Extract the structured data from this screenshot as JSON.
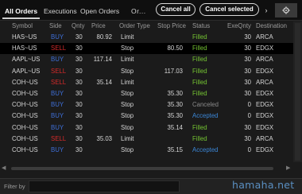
{
  "tabs": [
    {
      "label": "All Orders",
      "active": true
    },
    {
      "label": "Executions",
      "active": false
    },
    {
      "label": "Open Orders",
      "active": false
    },
    {
      "label": "Or...",
      "active": false
    }
  ],
  "toolbar": {
    "cancel_all": "Cancel all",
    "cancel_selected": "Cancel selected",
    "more_glyph": "›"
  },
  "table": {
    "columns": [
      "Symbol",
      "Side",
      "Qnty",
      "Price",
      "Order Type",
      "Stop Price",
      "Status",
      "ExeQnty",
      "Destination"
    ],
    "rows": [
      {
        "symbol": "HAS~US",
        "side": "BUY",
        "qnty": "30",
        "price": "80.92",
        "order_type": "Limit",
        "stop_price": "",
        "status": "Filled",
        "exe_qnty": "30",
        "destination": "ARCA"
      },
      {
        "symbol": "HAS~US",
        "side": "SELL",
        "qnty": "30",
        "price": "",
        "order_type": "Stop",
        "stop_price": "80.50",
        "status": "Filled",
        "exe_qnty": "30",
        "destination": "EDGX",
        "selected": true
      },
      {
        "symbol": "AAPL~US",
        "side": "BUY",
        "qnty": "30",
        "price": "117.14",
        "order_type": "Limit",
        "stop_price": "",
        "status": "Filled",
        "exe_qnty": "30",
        "destination": "ARCA"
      },
      {
        "symbol": "AAPL~US",
        "side": "SELL",
        "qnty": "30",
        "price": "",
        "order_type": "Stop",
        "stop_price": "117.03",
        "status": "Filled",
        "exe_qnty": "30",
        "destination": "EDGX"
      },
      {
        "symbol": "COH~US",
        "side": "SELL",
        "qnty": "30",
        "price": "35.14",
        "order_type": "Limit",
        "stop_price": "",
        "status": "Filled",
        "exe_qnty": "30",
        "destination": "ARCA"
      },
      {
        "symbol": "COH~US",
        "side": "BUY",
        "qnty": "30",
        "price": "",
        "order_type": "Stop",
        "stop_price": "35.30",
        "status": "Filled",
        "exe_qnty": "30",
        "destination": "EDGX"
      },
      {
        "symbol": "COH~US",
        "side": "BUY",
        "qnty": "30",
        "price": "",
        "order_type": "Stop",
        "stop_price": "35.30",
        "status": "Canceled",
        "exe_qnty": "0",
        "destination": "EDGX"
      },
      {
        "symbol": "COH~US",
        "side": "BUY",
        "qnty": "30",
        "price": "",
        "order_type": "Stop",
        "stop_price": "35.30",
        "status": "Accepted",
        "exe_qnty": "0",
        "destination": "EDGX"
      },
      {
        "symbol": "COH~US",
        "side": "BUY",
        "qnty": "30",
        "price": "",
        "order_type": "Stop",
        "stop_price": "35.14",
        "status": "Filled",
        "exe_qnty": "30",
        "destination": "EDGX"
      },
      {
        "symbol": "COH~US",
        "side": "SELL",
        "qnty": "30",
        "price": "35.03",
        "order_type": "Limit",
        "stop_price": "",
        "status": "Filled",
        "exe_qnty": "30",
        "destination": "ARCA"
      },
      {
        "symbol": "COH~US",
        "side": "BUY",
        "qnty": "30",
        "price": "",
        "order_type": "Stop",
        "stop_price": "35.15",
        "status": "Accepted",
        "exe_qnty": "0",
        "destination": "EDGX"
      }
    ]
  },
  "filter": {
    "label": "Filter by",
    "value": ""
  },
  "watermark": "hamaha.net",
  "colors": {
    "buy": "#3e6fd8",
    "sell": "#d42a2a",
    "filled": "#74c332",
    "canceled": "#8a8a8a",
    "accepted": "#3b86d6"
  },
  "icons": {
    "settings": "gear-icon",
    "scroll_left": "chevron-left-icon",
    "scroll_right": "chevron-right-icon"
  }
}
